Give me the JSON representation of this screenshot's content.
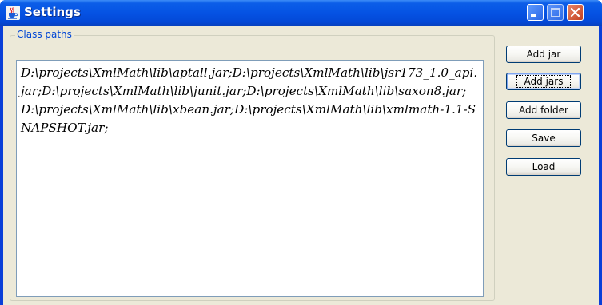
{
  "window": {
    "title": "Settings",
    "app_icon": "java-cup-icon",
    "controls": [
      "minimize-icon",
      "maximize-icon",
      "close-icon"
    ]
  },
  "class_paths": {
    "group_label": "Class paths",
    "value": "D:\\projects\\XmlMath\\lib\\aptall.jar;D:\\projects\\XmlMath\\lib\\jsr173_1.0_api.jar;D:\\projects\\XmlMath\\lib\\junit.jar;D:\\projects\\XmlMath\\lib\\saxon8.jar;D:\\projects\\XmlMath\\lib\\xbean.jar;D:\\projects\\XmlMath\\lib\\xmlmath-1.1-SNAPSHOT.jar;"
  },
  "buttons": {
    "add_jar": "Add jar",
    "add_jars": "Add jars",
    "add_folder": "Add folder",
    "save": "Save",
    "load": "Load"
  },
  "colors": {
    "titlebar": "#0552e3",
    "dialog_bg": "#ece9d8",
    "group_label": "#0046d5",
    "field_border": "#7f9db9"
  }
}
